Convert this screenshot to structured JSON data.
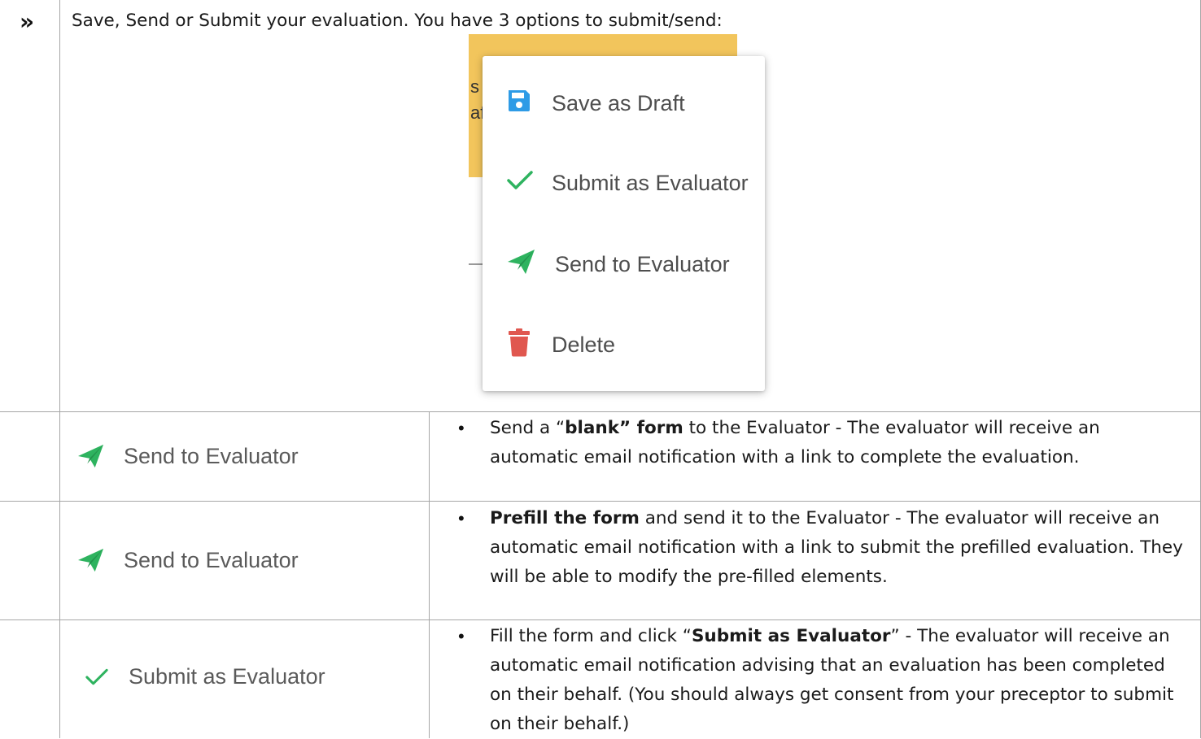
{
  "header": {
    "arrow_glyph": "»",
    "instruction": "Save, Send or Submit your evaluation. You have 3 options to submit/send:"
  },
  "popup": {
    "background_fragment_1": "s",
    "background_fragment_2": "af",
    "items": [
      {
        "label": "Save as Draft",
        "icon": "floppy-disk-icon",
        "color": "#2e9be6"
      },
      {
        "label": "Submit as Evaluator",
        "icon": "checkmark-icon",
        "color": "#2eb35f"
      },
      {
        "label": "Send to Evaluator",
        "icon": "paper-plane-icon",
        "color": "#2eb35f"
      },
      {
        "label": "Delete",
        "icon": "trash-icon",
        "color": "#e0574f"
      }
    ]
  },
  "rows": [
    {
      "button_label": "Send to Evaluator",
      "button_icon": "paper-plane-icon",
      "text_pre": "Send a “",
      "text_bold": "blank” form",
      "text_post": " to the Evaluator - The evaluator will receive an automatic email notification with a link to complete the evaluation."
    },
    {
      "button_label": "Send to Evaluator",
      "button_icon": "paper-plane-icon",
      "text_pre": "",
      "text_bold": "Prefill the form",
      "text_post": " and send it to the Evaluator - The evaluator will receive an automatic email notification with a link to submit the prefilled evaluation. They will be able to modify the pre-filled elements."
    },
    {
      "button_label": "Submit as Evaluator",
      "button_icon": "checkmark-icon",
      "text_pre": "Fill the form and click “",
      "text_bold": "Submit as Evaluator",
      "text_post": "” - The evaluator will receive an automatic email notification advising that an evaluation has been completed on their behalf.  (You should always get consent from your preceptor to submit on their behalf.)"
    }
  ],
  "colors": {
    "accent_green": "#2eb35f",
    "accent_blue": "#2e9be6",
    "accent_red": "#e0574f",
    "banner_yellow": "#f2c55c",
    "grid": "#a6a6a6"
  }
}
